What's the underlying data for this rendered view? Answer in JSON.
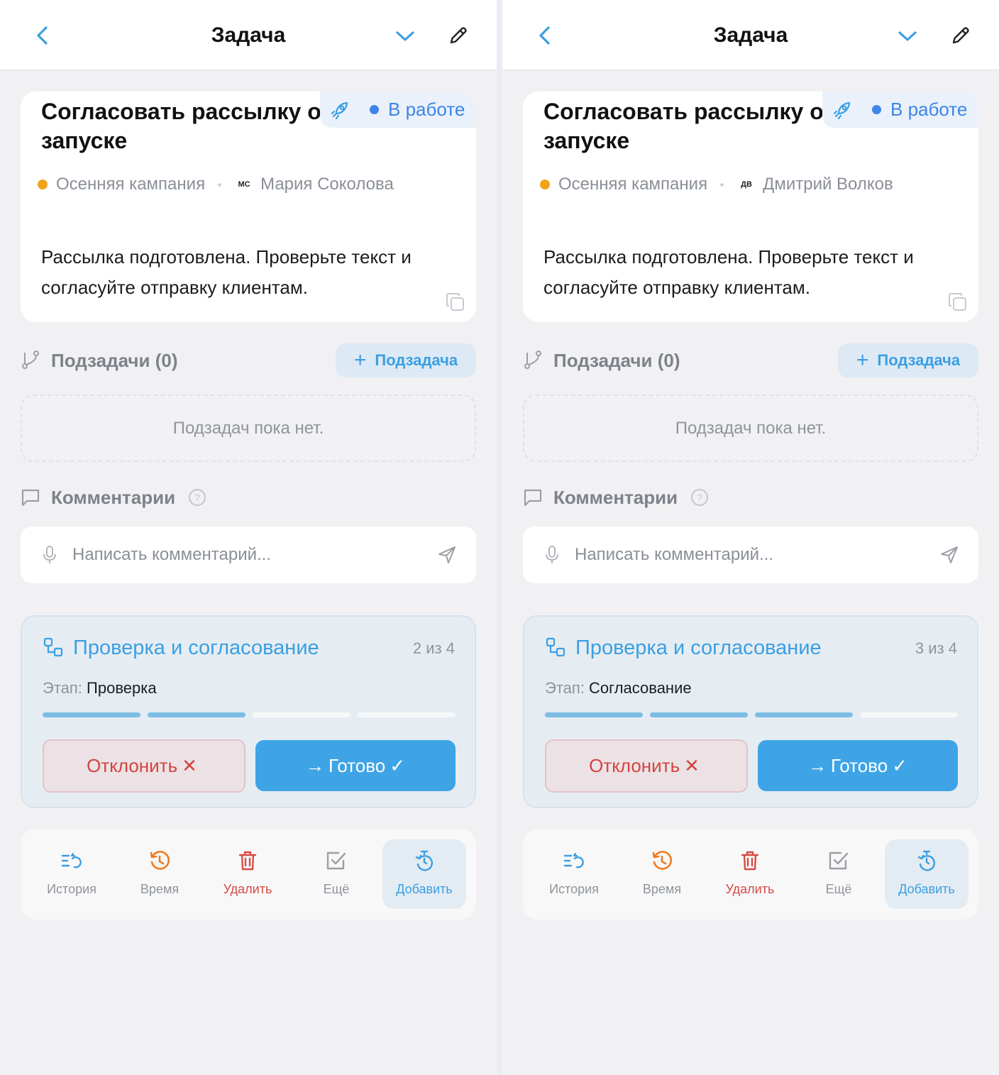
{
  "panels": [
    {
      "header": {
        "title": "Задача"
      },
      "task": {
        "title": "Согласовать рассылку о запуске",
        "status": "В работе",
        "project": "Осенняя кампания",
        "assignee_initials": "МС",
        "assignee": "Мария Соколова",
        "description": "Рассылка подготовлена. Проверьте текст и согласуйте отправку клиентам."
      },
      "subtasks": {
        "title": "Подзадачи (0)",
        "add_label": "Подзадача",
        "empty": "Подзадач пока нет."
      },
      "comments": {
        "title": "Комментарии",
        "placeholder": "Написать комментарий..."
      },
      "workflow": {
        "title": "Проверка и согласование",
        "count": "2 из 4",
        "stage_label": "Этап:",
        "stage": "Проверка",
        "progress_done": 2,
        "progress_total": 4,
        "reject_label": "Отклонить",
        "done_label": "Готово"
      },
      "actions": [
        {
          "label": "История",
          "icon": "history-list-icon"
        },
        {
          "label": "Время",
          "icon": "clock-history-icon"
        },
        {
          "label": "Удалить",
          "icon": "trash-icon"
        },
        {
          "label": "Ещё",
          "icon": "checkbox-icon"
        },
        {
          "label": "Добавить",
          "icon": "timer-add-icon"
        }
      ]
    },
    {
      "header": {
        "title": "Задача"
      },
      "task": {
        "title": "Согласовать рассылку о запуске",
        "status": "В работе",
        "project": "Осенняя кампания",
        "assignee_initials": "ДВ",
        "assignee": "Дмитрий Волков",
        "description": "Рассылка подготовлена. Проверьте текст и согласуйте отправку клиентам."
      },
      "subtasks": {
        "title": "Подзадачи (0)",
        "add_label": "Подзадача",
        "empty": "Подзадач пока нет."
      },
      "comments": {
        "title": "Комментарии",
        "placeholder": "Написать комментарий..."
      },
      "workflow": {
        "title": "Проверка и согласование",
        "count": "3 из 4",
        "stage_label": "Этап:",
        "stage": "Согласование",
        "progress_done": 3,
        "progress_total": 4,
        "reject_label": "Отклонить",
        "done_label": "Готово"
      },
      "actions": [
        {
          "label": "История",
          "icon": "history-list-icon"
        },
        {
          "label": "Время",
          "icon": "clock-history-icon"
        },
        {
          "label": "Удалить",
          "icon": "trash-icon"
        },
        {
          "label": "Ещё",
          "icon": "checkbox-icon"
        },
        {
          "label": "Добавить",
          "icon": "timer-add-icon"
        }
      ]
    }
  ],
  "colors": {
    "accent": "#3b9fe2",
    "status_blue": "#3d85e8",
    "project_orange": "#f0a21b",
    "danger": "#d84a45",
    "history_orange": "#f07a1c"
  }
}
